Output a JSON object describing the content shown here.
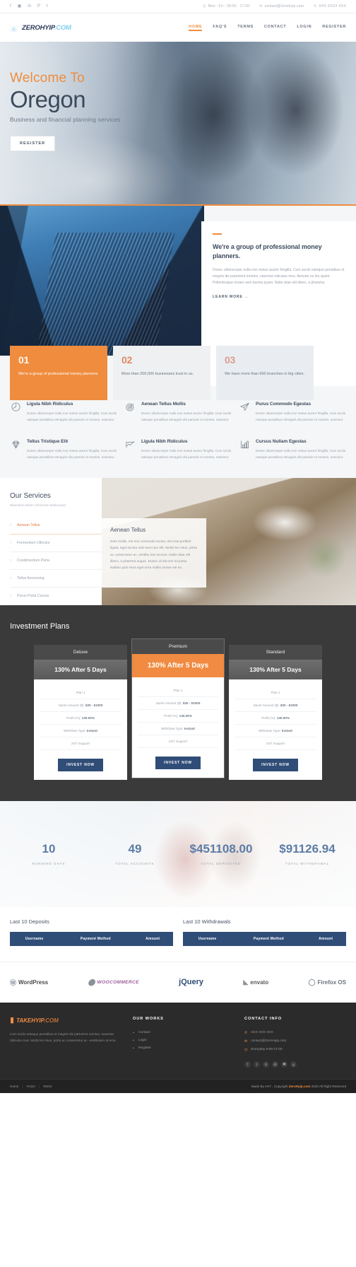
{
  "topbar": {
    "social": [
      "f",
      "▣",
      "in",
      "P",
      "t"
    ],
    "hours_icon": "clock-icon",
    "hours": "Mon - Fri : 09:00 - 17:00",
    "email_icon": "envelope-icon",
    "email": "contact@Zerohyip.com",
    "phone_icon": "phone-icon",
    "phone": "XXX XXXX XXX"
  },
  "header": {
    "logo_name": "ZEROHYIP",
    "logo_suffix": ".COM",
    "nav": [
      {
        "label": "HOME",
        "active": true
      },
      {
        "label": "FAQ'S",
        "active": false
      },
      {
        "label": "TERMS",
        "active": false
      },
      {
        "label": "CONTACT",
        "active": false
      },
      {
        "label": "LOGIN",
        "active": false
      },
      {
        "label": "REGISTER",
        "active": false
      }
    ]
  },
  "hero": {
    "welcome": "Welcome To",
    "title": "Oregon",
    "subtitle": "Business and financial planning services",
    "button": "REGISTER"
  },
  "about": {
    "heading": "We're a group of professional money planners.",
    "paragraph": "Donec ullamcorper nulla non metus auctor fringilla. Cum sociis natoque penatibus et magnis dis parturient montes, nascetur ridiculus mus. Aenean eu leo quam. Pellentesque ornare sem lacinia quam. Nulla vitae elit libero, a pharetra.",
    "learn_more": "LEARN MORE →",
    "boxes": [
      {
        "num": "01",
        "text": "We're a group of professional money planners."
      },
      {
        "num": "02",
        "text": "More than 200,000 businesses trust in us."
      },
      {
        "num": "03",
        "text": "We have more than 600 branches in big cities."
      }
    ]
  },
  "features": [
    {
      "icon": "clock-pie-icon",
      "title": "Ligula Nibh Ridiculus",
      "text": "Donec ullamcorper nulla non metus auctor fringilla. Cum sociis natoque penatibus etmagnis dis parturie nt montes, nascetur."
    },
    {
      "icon": "target-icon",
      "title": "Aenean Tellus Mollis",
      "text": "Donec ullamcorper nulla non metus auctor fringilla. Cum sociis natoque penatibus etmagnis dis parturie nt montes, nascetur."
    },
    {
      "icon": "paper-plane-icon",
      "title": "Purus Commodo Egestas",
      "text": "Donec ullamcorper nulla non metus auctor fringilla. Cum sociis natoque penatibus etmagnis dis parturie nt montes, nascetur."
    },
    {
      "icon": "diamond-icon",
      "title": "Tellus Tristique Elit",
      "text": "Donec ullamcorper nulla non metus auctor fringilla. Cum sociis natoque penatibus etmagnis dis parturie nt montes, nascetur."
    },
    {
      "icon": "line-chart-icon",
      "title": "Ligula Nibh Ridiculus",
      "text": "Donec ullamcorper nulla non metus auctor fringilla. Cum sociis natoque penatibus etmagnis dis parturie nt montes, nascetur."
    },
    {
      "icon": "bar-chart-icon",
      "title": "Cursus Nullam Egestas",
      "text": "Donec ullamcorper nulla non metus auctor fringilla. Cum sociis natoque penatibus etmagnis dis parturie nt montes, nascetur."
    }
  ],
  "services": {
    "heading": "Our Services",
    "subtitle": "Bibendum Etiam Venenatis Malesuada",
    "items": [
      {
        "label": "Aenean Tellus",
        "active": true
      },
      {
        "label": "Fermentum Ultricies",
        "active": false
      },
      {
        "label": "Condimentum Porta",
        "active": false
      },
      {
        "label": "Tellus Aenessing",
        "active": false
      },
      {
        "label": "Purus Porta Cursus",
        "active": false
      }
    ],
    "card_title": "Aenean Tellus",
    "card_text": "Duis mollis, est non commodo luctus, nisi erat porttitor ligula, eget lacinia odio sem nec elit. Morbi leo risus, porta ac consectetur ac, vestibu lum at eros. Nulla vitae elit libero, a pharetra augue. Donec id elit non mi porta. Nullam quis risus eget urna mollis ornare vel eu."
  },
  "plans": {
    "heading": "Investment Plans",
    "cards": [
      {
        "name": "Deluxe",
        "rate": "130% After 5 Days",
        "featured": false,
        "rows": [
          {
            "label": "Plan 1",
            "value": ""
          },
          {
            "label": "Spent Amount ($):",
            "value": "$20 - $1000"
          },
          {
            "label": "Profit (%):",
            "value": "130.00%"
          },
          {
            "label": "Withdraw Type:",
            "value": "Instant"
          },
          {
            "label": "24/7 Support",
            "value": ""
          }
        ],
        "button": "INVEST NOW"
      },
      {
        "name": "Premium",
        "rate": "130% After 5 Days",
        "featured": true,
        "rows": [
          {
            "label": "Plan 1",
            "value": ""
          },
          {
            "label": "Spent Amount ($):",
            "value": "$20 - $1000"
          },
          {
            "label": "Profit (%):",
            "value": "130.00%"
          },
          {
            "label": "Withdraw Type:",
            "value": "Instant"
          },
          {
            "label": "24/7 Support",
            "value": ""
          }
        ],
        "button": "INVEST NOW"
      },
      {
        "name": "Standard",
        "rate": "130% After 5 Days",
        "featured": false,
        "rows": [
          {
            "label": "Plan 1",
            "value": ""
          },
          {
            "label": "Spent Amount ($):",
            "value": "$20 - $1000"
          },
          {
            "label": "Profit (%):",
            "value": "130.00%"
          },
          {
            "label": "Withdraw Type:",
            "value": "Instant"
          },
          {
            "label": "24/7 Support",
            "value": ""
          }
        ],
        "button": "INVEST NOW"
      }
    ]
  },
  "stats": [
    {
      "value": "10",
      "label": "RUNNING DAYS"
    },
    {
      "value": "49",
      "label": "TOTAL ACCOUNTS"
    },
    {
      "value": "$451108.00",
      "label": "TOTAL DEPOSITED"
    },
    {
      "value": "$91126.94",
      "label": "TOTAL WITHDRAWAL"
    }
  ],
  "tables": {
    "deposits_title": "Last 10 Deposits",
    "withdrawals_title": "Last 10 Withdrawals",
    "columns": [
      "Username",
      "Payment Method",
      "Amount"
    ]
  },
  "brands": [
    {
      "icon": "wordpress-icon",
      "label": "WordPress",
      "cls": "wp"
    },
    {
      "icon": "woocommerce-icon",
      "label": "WOOCOMMERCE",
      "cls": "woo"
    },
    {
      "icon": "jquery-icon",
      "label": "jQuery",
      "cls": "jq"
    },
    {
      "icon": "envato-icon",
      "label": "envato",
      "cls": "env"
    },
    {
      "icon": "firefox-icon",
      "label": "Firefox OS",
      "cls": "ff"
    }
  ],
  "footer": {
    "logo_name": "TAKEHYIP",
    "logo_suffix": ".COM",
    "about": "Cum sociis natoque penatibus et magnis dis parturient montes, nascetur ridiculus mus. Morbi leo risus, porta ac consectetur ac, vestibulum at eros.",
    "works_title": "OUR WORKS",
    "works": [
      "Contact",
      "Login",
      "Register"
    ],
    "contact_title": "CONTACT INFO",
    "contact": [
      {
        "icon": "phone-icon",
        "text": "XXX XXX XXX"
      },
      {
        "icon": "envelope-icon",
        "text": "contact@ZeroHyip.com"
      },
      {
        "icon": "clock-icon",
        "text": "Everyday 9:00-17:00"
      }
    ],
    "social": [
      "f",
      "t",
      "G",
      "@",
      "▣",
      "g"
    ]
  },
  "copybar": {
    "links": [
      "Home",
      "FAQ's",
      "Terms"
    ],
    "text_prefix": "Made By AHT , Copyright ",
    "brand": "ZeroHyip.com",
    "text_suffix": " 2020 All Right Reserved"
  },
  "colors": {
    "accent": "#ef8c3e",
    "dark": "#3a3a3a",
    "navy": "#2f4d77",
    "stat": "#5b7ca6"
  }
}
